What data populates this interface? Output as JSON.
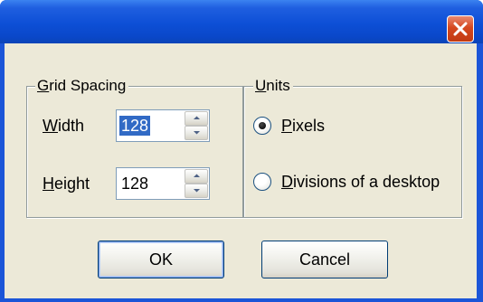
{
  "titlebar": {
    "close_icon": "close-icon",
    "close_color": "#d5481f"
  },
  "grid_spacing": {
    "legend_prefix": "",
    "legend_mnemonic": "G",
    "legend_rest": "rid Spacing",
    "width": {
      "label_mnemonic": "W",
      "label_rest": "idth",
      "value": "128",
      "selected": true
    },
    "height": {
      "label_mnemonic": "H",
      "label_rest": "eight",
      "value": "128",
      "selected": false
    }
  },
  "units": {
    "legend_mnemonic": "U",
    "legend_rest": "nits",
    "options": [
      {
        "label_mnemonic": "P",
        "label_rest": "ixels",
        "checked": true
      },
      {
        "label_mnemonic": "D",
        "label_rest": "ivisions of a desktop",
        "checked": false
      }
    ]
  },
  "buttons": {
    "ok_label": "OK",
    "cancel_label": "Cancel"
  },
  "colors": {
    "titlebar": "#0d4fd6",
    "client_background": "#ece9d8",
    "selection": "#316ac5"
  }
}
